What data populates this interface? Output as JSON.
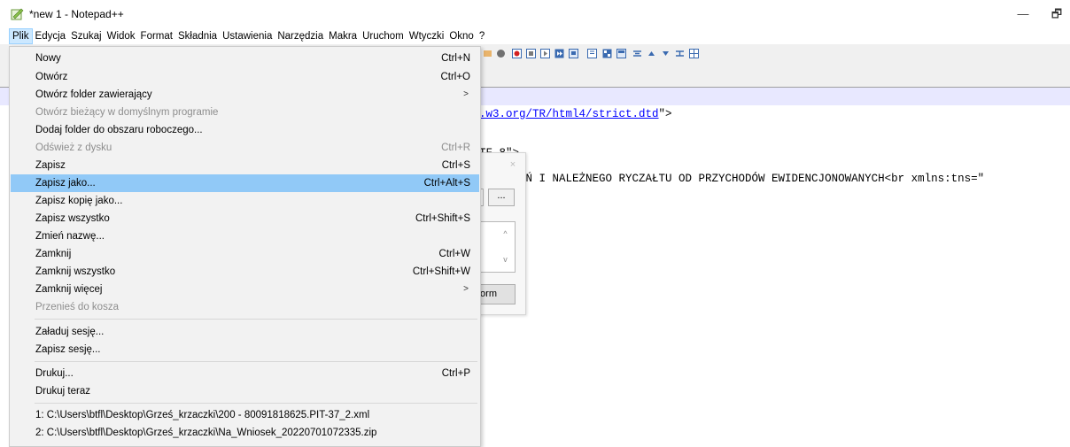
{
  "window": {
    "title": "*new 1 - Notepad++",
    "minimize_glyph": "—",
    "restore_glyph": "🗗"
  },
  "menubar": [
    "Plik",
    "Edycja",
    "Szukaj",
    "Widok",
    "Format",
    "Składnia",
    "Ustawienia",
    "Narzędzia",
    "Makra",
    "Uruchom",
    "Wtyczki",
    "Okno",
    "?"
  ],
  "editor": {
    "lines": [
      {
        "text": ".w3.org/TR/html4/strict.dtd\">",
        "link": ".w3.org/TR/html4/strict.dtd",
        "tail": "\">"
      },
      {
        "text": "TF-8\">"
      },
      {
        "text": "ODLICZEŃ I NALEŻNEGO RYCZAŁTU OD PRZYCHODÓW EWIDENCJONOWANYCH<br xmlns:tns=\""
      }
    ]
  },
  "dialog": {
    "close_glyph": "×",
    "browse_label": "...",
    "scroll_up": "^",
    "scroll_down": "v",
    "form_button": "form"
  },
  "file_menu": {
    "items": [
      {
        "label": "Nowy",
        "shortcut": "Ctrl+N"
      },
      {
        "label": "Otwórz",
        "shortcut": "Ctrl+O"
      },
      {
        "label": "Otwórz folder zawierający",
        "submenu": ">"
      },
      {
        "label": "Otwórz bieżący w domyślnym programie",
        "disabled": true
      },
      {
        "label": "Dodaj folder do obszaru roboczego..."
      },
      {
        "label": "Odśwież z dysku",
        "shortcut": "Ctrl+R",
        "disabled": true
      },
      {
        "label": "Zapisz",
        "shortcut": "Ctrl+S"
      },
      {
        "label": "Zapisz jako...",
        "shortcut": "Ctrl+Alt+S",
        "selected": true
      },
      {
        "label": "Zapisz kopię jako..."
      },
      {
        "label": "Zapisz wszystko",
        "shortcut": "Ctrl+Shift+S"
      },
      {
        "label": "Zmień nazwę..."
      },
      {
        "label": "Zamknij",
        "shortcut": "Ctrl+W"
      },
      {
        "label": "Zamknij wszystko",
        "shortcut": "Ctrl+Shift+W"
      },
      {
        "label": "Zamknij więcej",
        "submenu": ">"
      },
      {
        "label": "Przenieś do kosza",
        "disabled": true
      },
      {
        "label": "Załaduj sesję..."
      },
      {
        "label": "Zapisz sesję..."
      },
      {
        "label": "Drukuj...",
        "shortcut": "Ctrl+P"
      },
      {
        "label": "Drukuj teraz"
      },
      {
        "label": "1: C:\\Users\\btfl\\Desktop\\Grześ_krzaczki\\200 - 80091818625.PIT-37_2.xml"
      },
      {
        "label": "2: C:\\Users\\btfl\\Desktop\\Grześ_krzaczki\\Na_Wniosek_20220701072335.zip"
      }
    ]
  },
  "colors": {
    "menu_bg": "#f2f2f2",
    "selected_bg": "#91c9f7",
    "disabled_text": "#8d8d8d",
    "highlight_line": "#e8e8ff"
  }
}
